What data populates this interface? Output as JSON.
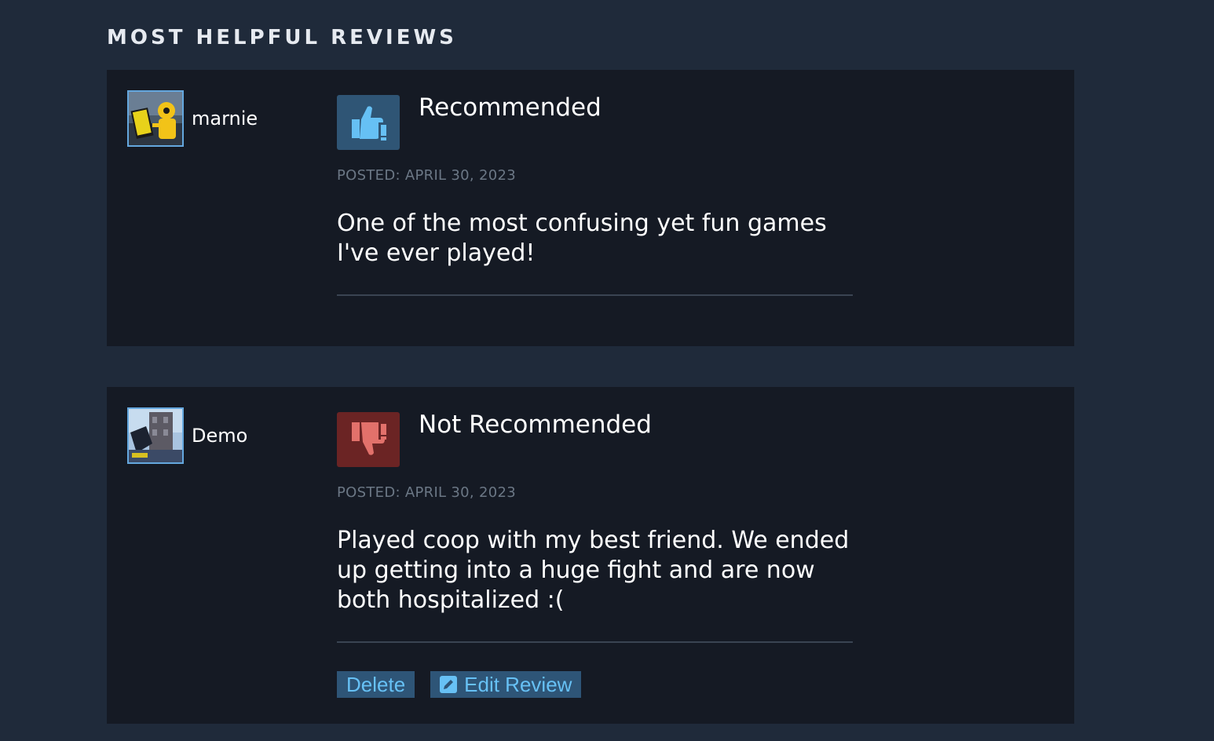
{
  "section": {
    "title": "MOST HELPFUL REVIEWS"
  },
  "reviews": [
    {
      "author": "marnie",
      "avatar_icon": "crash-test-dummy-avatar",
      "verdict": "Recommended",
      "verdict_icon": "thumbs-up-icon",
      "posted": "POSTED: APRIL 30, 2023",
      "text": "One of the most confusing yet fun games I've ever played!"
    },
    {
      "author": "Demo",
      "avatar_icon": "building-avatar",
      "verdict": "Not Recommended",
      "verdict_icon": "thumbs-down-icon",
      "posted": "POSTED: APRIL 30, 2023",
      "text": "Played coop with my best friend. We ended up getting into a huge fight and are now both hospitalized :(",
      "actions": {
        "delete_label": "Delete",
        "edit_label": "Edit Review"
      }
    }
  ],
  "colors": {
    "background": "#1f2a3a",
    "card": "#151a24",
    "thumbs_up_bg": "#2f5575",
    "thumbs_up_icon": "#66c0f4",
    "thumbs_down_bg": "#6b2424",
    "thumbs_down_icon": "#e2716b",
    "button_bg": "#2e5577",
    "button_text": "#67c1f5"
  }
}
